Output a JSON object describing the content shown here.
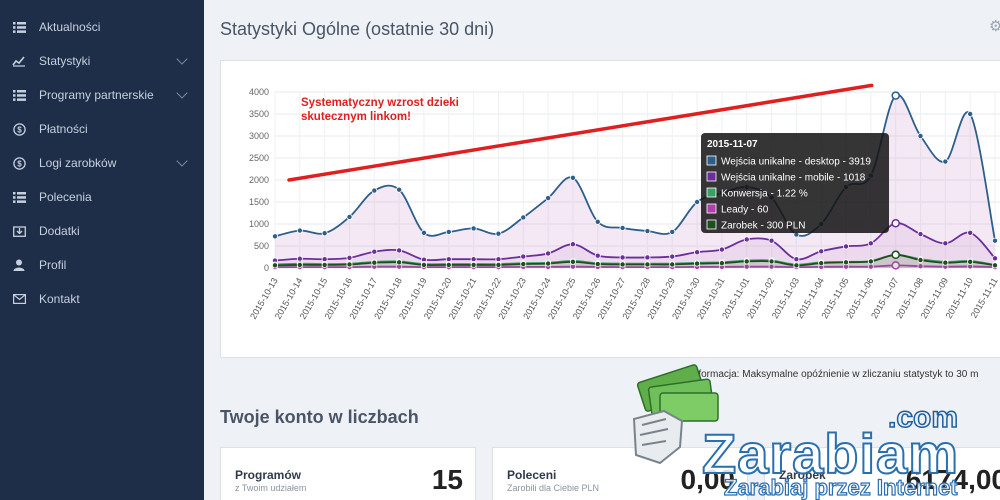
{
  "sidebar": {
    "items": [
      {
        "label": "Aktualności",
        "icon": "list-icon",
        "expandable": false
      },
      {
        "label": "Statystyki",
        "icon": "chart-icon",
        "expandable": true
      },
      {
        "label": "Programy partnerskie",
        "icon": "list-icon",
        "expandable": true
      },
      {
        "label": "Płatności",
        "icon": "dollar-circle-icon",
        "expandable": false
      },
      {
        "label": "Logi zarobków",
        "icon": "dollar-circle-icon",
        "expandable": true
      },
      {
        "label": "Polecenia",
        "icon": "list-icon",
        "expandable": false
      },
      {
        "label": "Dodatki",
        "icon": "download-box-icon",
        "expandable": false
      },
      {
        "label": "Profil",
        "icon": "user-icon",
        "expandable": false
      },
      {
        "label": "Kontakt",
        "icon": "envelope-icon",
        "expandable": false
      }
    ]
  },
  "header": {
    "title": "Statystyki Ogólne (ostatnie 30 dni)"
  },
  "chart_data": {
    "type": "area",
    "title": "",
    "xlabel": "",
    "ylabel": "",
    "ylim": [
      0,
      4000
    ],
    "yticks": [
      0,
      500,
      1000,
      1500,
      2000,
      2500,
      3000,
      3500,
      4000
    ],
    "grid": true,
    "categories": [
      "2015-10-13",
      "2015-10-14",
      "2015-10-15",
      "2015-10-16",
      "2015-10-17",
      "2015-10-18",
      "2015-10-19",
      "2015-10-20",
      "2015-10-21",
      "2015-10-22",
      "2015-10-23",
      "2015-10-24",
      "2015-10-25",
      "2015-10-26",
      "2015-10-27",
      "2015-10-28",
      "2015-10-29",
      "2015-10-30",
      "2015-10-31",
      "2015-11-01",
      "2015-11-02",
      "2015-11-03",
      "2015-11-04",
      "2015-11-05",
      "2015-11-06",
      "2015-11-07",
      "2015-11-08",
      "2015-11-09",
      "2015-11-10",
      "2015-11-11"
    ],
    "series": [
      {
        "name": "Wejścia unikalne - desktop",
        "color": "#2e5e8a",
        "fill": "rgba(205,150,205,0.22)",
        "values": [
          720,
          850,
          790,
          1160,
          1760,
          1780,
          800,
          820,
          900,
          780,
          1150,
          1590,
          2050,
          1050,
          910,
          840,
          820,
          1500,
          1700,
          1840,
          1600,
          760,
          1000,
          1840,
          2100,
          3919,
          3000,
          2420,
          3500,
          620
        ]
      },
      {
        "name": "Wejścia unikalne - mobile",
        "color": "#6b2e9a",
        "fill": "rgba(205,150,205,0.18)",
        "values": [
          170,
          210,
          200,
          230,
          370,
          400,
          190,
          200,
          200,
          200,
          260,
          330,
          540,
          280,
          240,
          240,
          260,
          360,
          420,
          650,
          620,
          200,
          380,
          490,
          560,
          1018,
          770,
          560,
          800,
          220
        ]
      },
      {
        "name": "Konwersja",
        "unit": "%",
        "color": "#3aa068",
        "fill": "none",
        "values": [
          80,
          100,
          90,
          100,
          140,
          150,
          90,
          90,
          90,
          90,
          110,
          120,
          160,
          110,
          100,
          100,
          100,
          120,
          130,
          170,
          170,
          80,
          130,
          140,
          160,
          300,
          200,
          140,
          160,
          70
        ]
      },
      {
        "name": "Leady",
        "color": "#b040b0",
        "fill": "none",
        "values": [
          20,
          20,
          20,
          20,
          30,
          30,
          20,
          20,
          20,
          20,
          25,
          25,
          30,
          25,
          20,
          20,
          20,
          25,
          25,
          30,
          30,
          20,
          25,
          30,
          30,
          60,
          40,
          30,
          35,
          20
        ]
      },
      {
        "name": "Zarobek",
        "unit": "PLN",
        "color": "#1f4f1f",
        "fill": "rgba(60,110,60,0.18)",
        "values": [
          60,
          70,
          70,
          80,
          120,
          130,
          70,
          70,
          70,
          70,
          90,
          100,
          140,
          90,
          80,
          80,
          80,
          100,
          110,
          150,
          150,
          60,
          110,
          130,
          150,
          300,
          180,
          120,
          140,
          60
        ]
      }
    ],
    "annotation": {
      "text": [
        "Systematyczny wzrost dzieki",
        "skutecznym linkom!"
      ],
      "color": "#e02020",
      "arrow_from": [
        "2015-10-13",
        2000
      ],
      "arrow_to": [
        "2015-11-07",
        4150
      ]
    },
    "tooltip": {
      "date": "2015-11-07",
      "rows": [
        {
          "color": "#2e5e8a",
          "text": "Wejścia unikalne - desktop - 3919"
        },
        {
          "color": "#6b2e9a",
          "text": "Wejścia unikalne - mobile - 1018"
        },
        {
          "color": "#3aa068",
          "text": "Konwersja - 1.22 %"
        },
        {
          "color": "#b040b0",
          "text": "Leady - 60"
        },
        {
          "color": "#1f4f1f",
          "text": "Zarobek - 300 PLN"
        }
      ]
    }
  },
  "info": {
    "text": "Informacja: Maksymalne opóźnienie w zliczaniu statystyk to 30 m"
  },
  "section": {
    "title": "Twoje konto w liczbach"
  },
  "stats": [
    {
      "label": "Programów",
      "sub": "z Twoim udziałem",
      "value": "15"
    },
    {
      "label": "Poleceni",
      "sub": "Zarobili dla Ciebie PLN",
      "value": "0,00"
    },
    {
      "label": "Zarobek",
      "sub": "",
      "value": "6174,00"
    }
  ],
  "watermark": {
    "brand": "Zarabiam",
    "tld": ".com",
    "tagline": "Zarabiaj przez Internet",
    "colors": {
      "primary": "#2a6fb0",
      "money": "#5fae4a"
    }
  }
}
